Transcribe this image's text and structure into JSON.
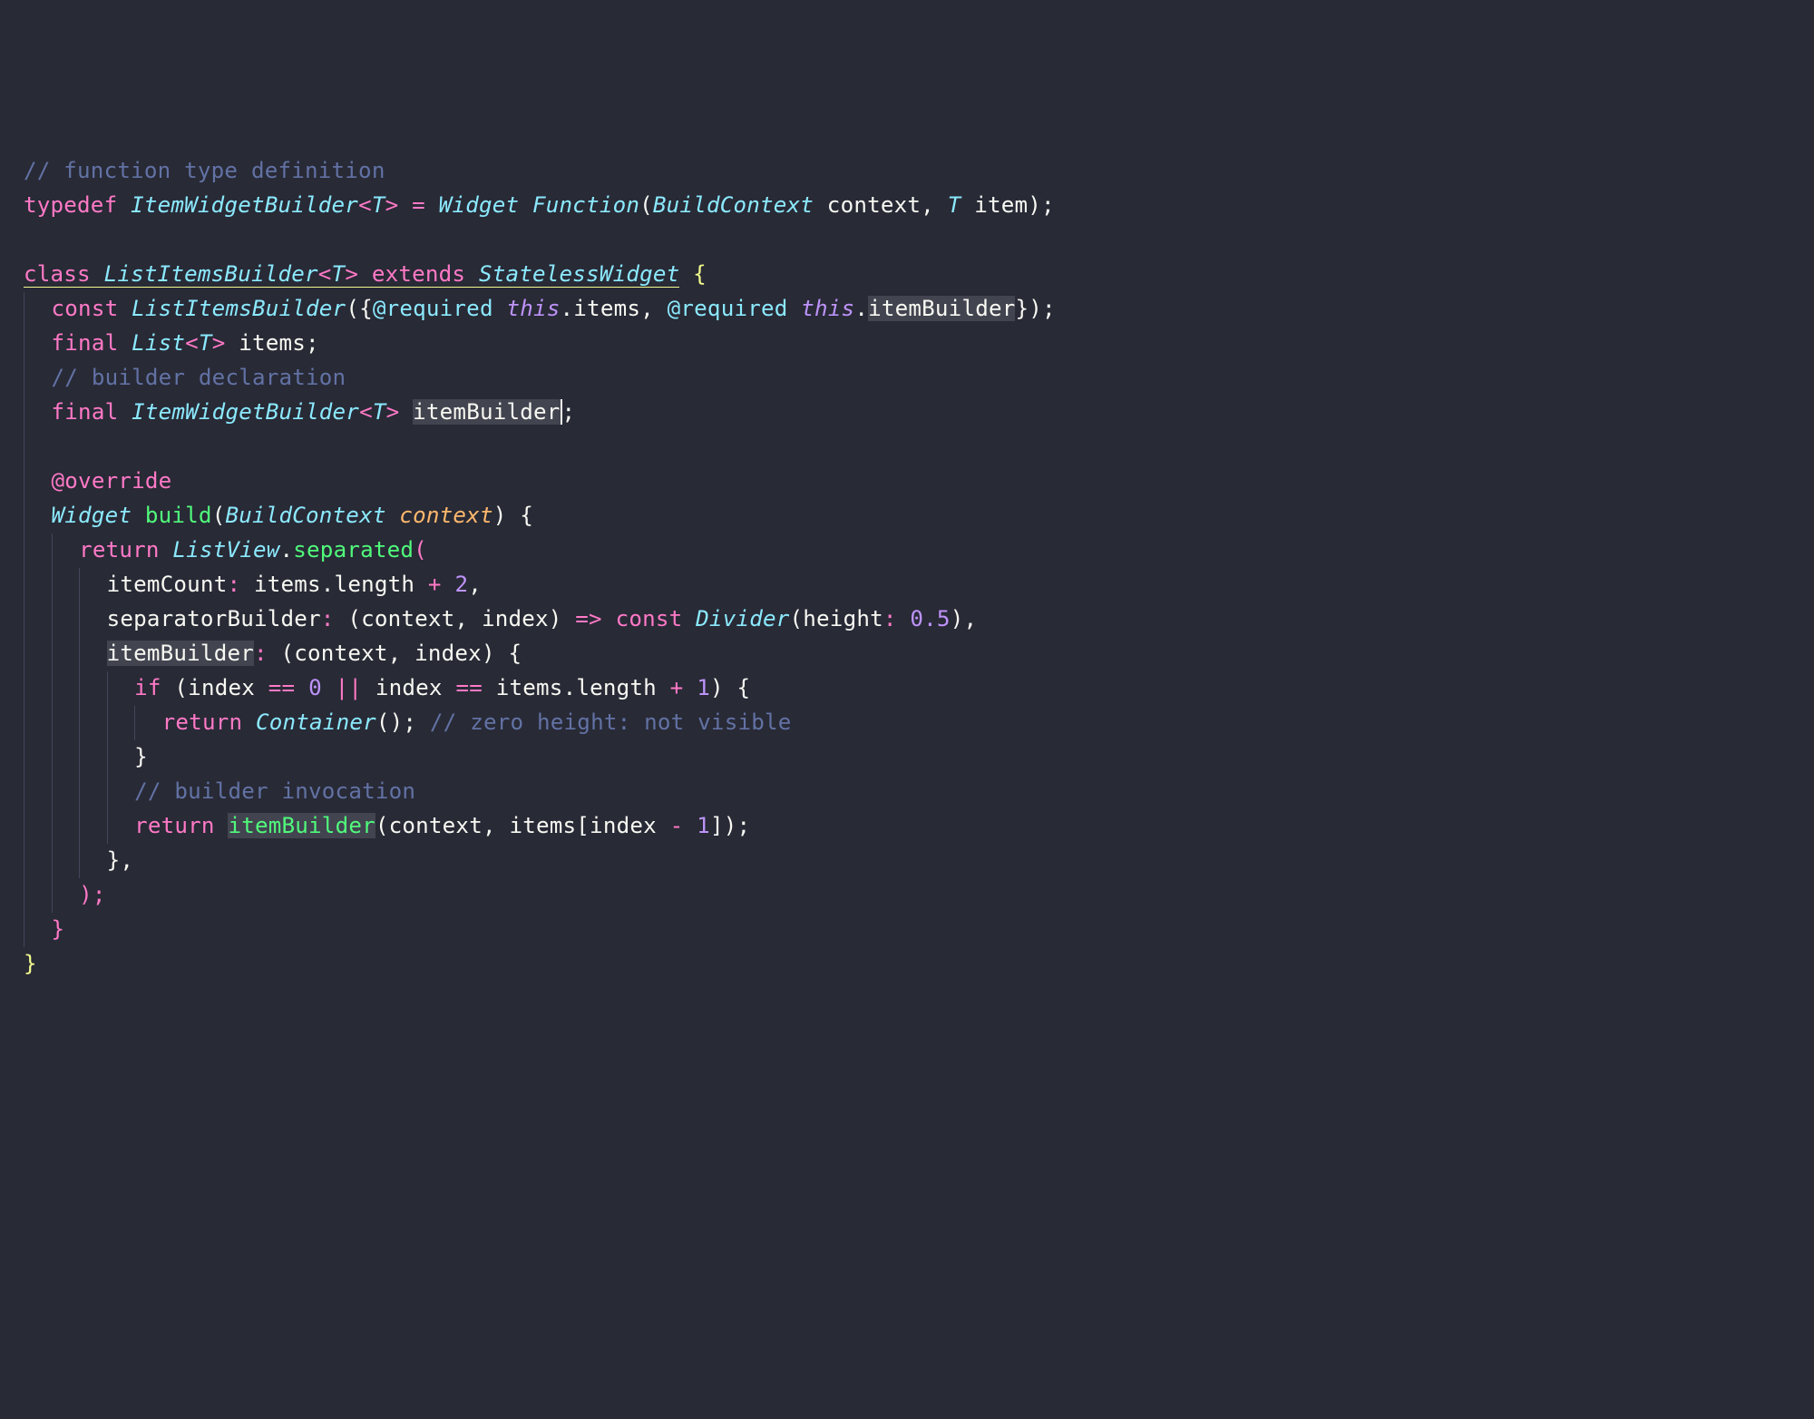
{
  "code": {
    "comment_typedef": "// function type definition",
    "kw_typedef": "typedef",
    "type_ItemWidgetBuilder": "ItemWidgetBuilder",
    "angle_open": "<",
    "type_T": "T",
    "angle_close": ">",
    "equals": " = ",
    "type_Widget": "Widget",
    "type_Function": "Function",
    "paren_open": "(",
    "type_BuildContext": "BuildContext",
    "param_context": " context",
    "comma": ", ",
    "param_item": " item",
    "paren_close_semi": ");",
    "kw_class": "class",
    "type_ListItemsBuilder": "ListItemsBuilder",
    "kw_extends": "extends",
    "type_StatelessWidget": "StatelessWidget",
    "brace_open": " {",
    "kw_const": "const",
    "ctor_ListItemsBuilder": "ListItemsBuilder",
    "brace_open2": "({",
    "annotation_required": "@required",
    "kw_this": "this",
    "dot_items": ".items",
    "dot_itemBuilder": ".",
    "text_itemBuilder": "itemBuilder",
    "brace_close_paren_semi": "});",
    "kw_final": "final",
    "type_List": "List",
    "text_items_semi": " items;",
    "comment_builder_decl": "// builder declaration",
    "text_itemBuilder_cursor": "itemBuilder",
    "semi": ";",
    "annotation_override": "@override",
    "func_build": "build",
    "param_context2": " context",
    "paren_close": ")",
    "brace_open3": " {",
    "kw_return": "return",
    "type_ListView": "ListView",
    "dot": ".",
    "func_separated": "separated",
    "param_itemCount": "itemCount",
    "colon_sp": ": ",
    "text_items_length": "items.length ",
    "op_plus": "+",
    "sp": " ",
    "num_2": "2",
    "comma_only": ",",
    "param_separatorBuilder": "separatorBuilder",
    "text_lambda_args": "(context, index) ",
    "arrow": "=>",
    "type_Divider": "Divider",
    "param_height": "height",
    "num_05": "0.5",
    "paren_close_comma": "),",
    "param_itemBuilder_hl": "itemBuilder",
    "text_lambda_args2": "(context, index) {",
    "kw_if": "if",
    "text_if_open": " (index ",
    "op_eq": "==",
    "num_0": "0",
    "op_or": "||",
    "text_index": " index ",
    "text_items_length2": " items.length ",
    "num_1": "1",
    "text_close_brace": ") {",
    "type_Container": "Container",
    "text_unit_semi": "(); ",
    "comment_zero_height": "// zero height: not visible",
    "brace_close": "}",
    "comment_builder_invocation": "// builder invocation",
    "text_itemBuilder_call": "itemBuilder",
    "text_call_args": "(context, items[index ",
    "op_minus": "-",
    "text_close_bracket": "]);",
    "brace_close_comma": "},",
    "paren_close_semi2": ");"
  }
}
